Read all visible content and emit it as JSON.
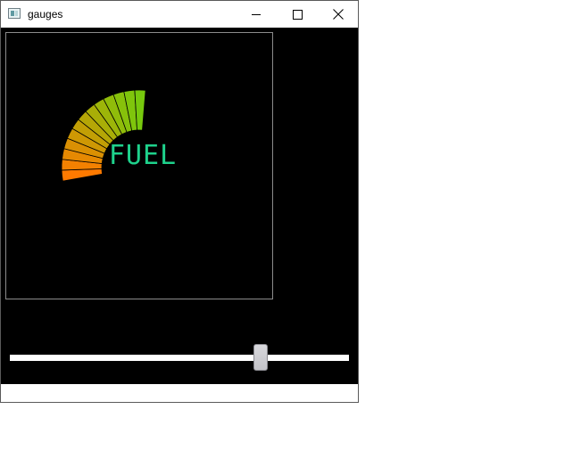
{
  "window": {
    "title": "gauges",
    "icon": "app-window-icon",
    "controls": [
      "minimize-icon",
      "maximize-icon",
      "close-icon"
    ]
  },
  "gauge": {
    "label": "FUEL",
    "label_color": "#1ed28c",
    "background": "#000000",
    "frame_color": "#8c8c8c",
    "level": 0.74,
    "segments": 18,
    "start_angle_deg": 190,
    "end_angle_deg": 45,
    "color_low": "#ff7a00",
    "color_mid": "#8cbf0a",
    "color_high": "#50dc14"
  },
  "slider": {
    "value": 0.74,
    "track_color": "#ffffff",
    "thumb_color": "#c8c8cc"
  }
}
